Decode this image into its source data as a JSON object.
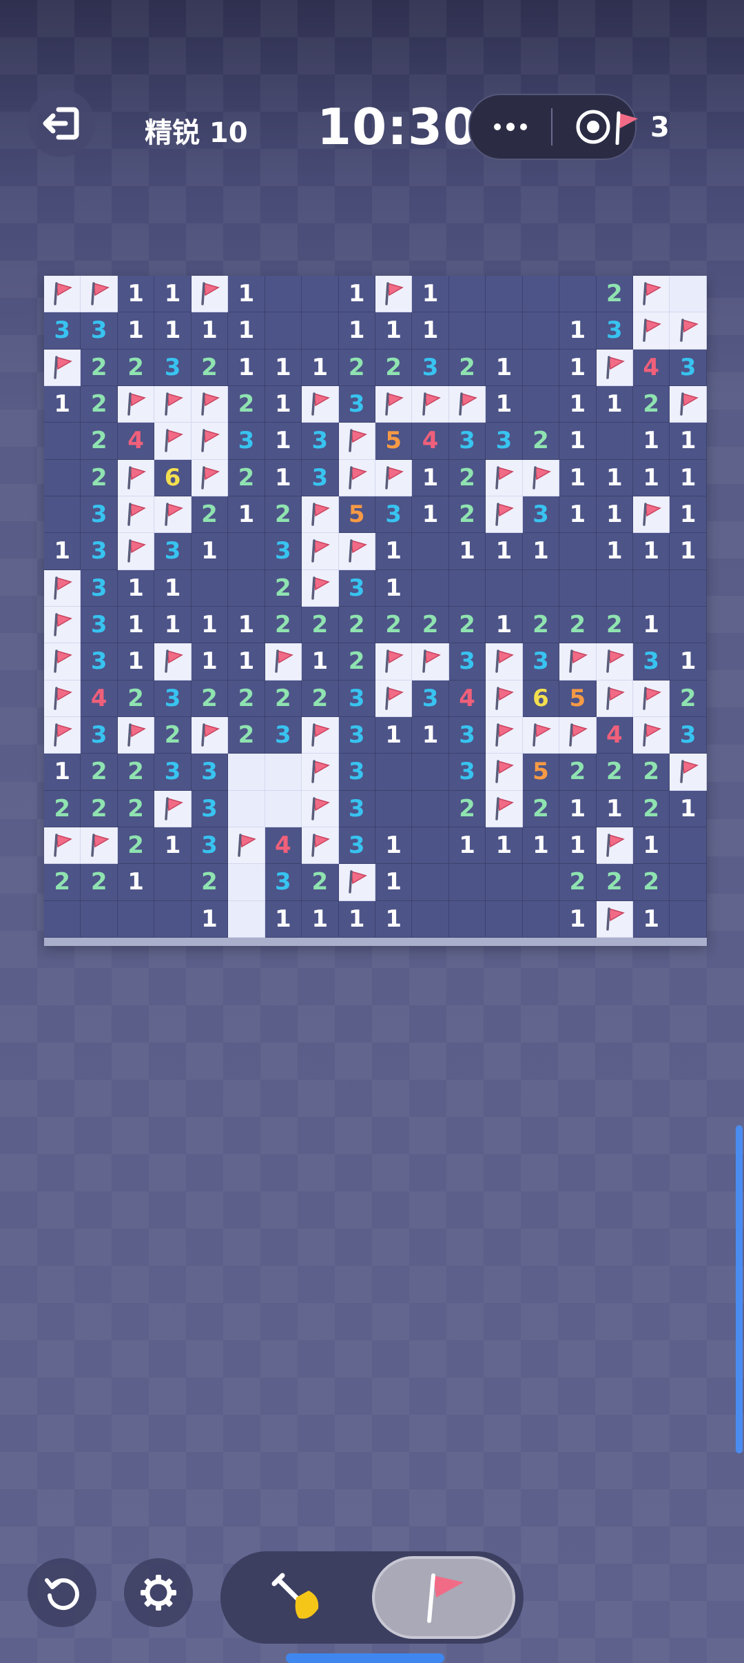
{
  "header": {
    "level_label": "精锐 10",
    "timer": "10:30",
    "flags_remaining": "3"
  },
  "board": {
    "rows": 18,
    "cols": 18,
    "legend": "F = flagged cell, H = unrevealed cell, blank = revealed empty, digit = adjacent mine count",
    "cells": [
      [
        "F",
        "F",
        "1",
        "1",
        "F",
        "1",
        "",
        "",
        "1",
        "F",
        "1",
        "",
        "",
        "",
        "",
        "2",
        "F",
        "H"
      ],
      [
        "3",
        "3",
        "1",
        "1",
        "1",
        "1",
        "",
        "",
        "1",
        "1",
        "1",
        "",
        "",
        "",
        "1",
        "3",
        "F",
        "F"
      ],
      [
        "F",
        "2",
        "2",
        "3",
        "2",
        "1",
        "1",
        "1",
        "2",
        "2",
        "3",
        "2",
        "1",
        "",
        "1",
        "F",
        "4",
        "3"
      ],
      [
        "1",
        "2",
        "F",
        "F",
        "F",
        "2",
        "1",
        "F",
        "3",
        "F",
        "F",
        "F",
        "1",
        "",
        "1",
        "1",
        "2",
        "F"
      ],
      [
        "",
        "2",
        "4",
        "F",
        "F",
        "3",
        "1",
        "3",
        "F",
        "5",
        "4",
        "3",
        "3",
        "2",
        "1",
        "",
        "1",
        "1"
      ],
      [
        "",
        "2",
        "F",
        "6",
        "F",
        "2",
        "1",
        "3",
        "F",
        "F",
        "1",
        "2",
        "F",
        "F",
        "1",
        "1",
        "1",
        "1"
      ],
      [
        "",
        "3",
        "F",
        "F",
        "2",
        "1",
        "2",
        "F",
        "5",
        "3",
        "1",
        "2",
        "F",
        "3",
        "1",
        "1",
        "F",
        "1"
      ],
      [
        "1",
        "3",
        "F",
        "3",
        "1",
        "",
        "3",
        "F",
        "F",
        "1",
        "",
        "1",
        "1",
        "1",
        "",
        "1",
        "1",
        "1"
      ],
      [
        "F",
        "3",
        "1",
        "1",
        "",
        "",
        "2",
        "F",
        "3",
        "1",
        "",
        "",
        "",
        "",
        "",
        "",
        "",
        ""
      ],
      [
        "F",
        "3",
        "1",
        "1",
        "1",
        "1",
        "2",
        "2",
        "2",
        "2",
        "2",
        "2",
        "1",
        "2",
        "2",
        "2",
        "1",
        ""
      ],
      [
        "F",
        "3",
        "1",
        "F",
        "1",
        "1",
        "F",
        "1",
        "2",
        "F",
        "F",
        "3",
        "F",
        "3",
        "F",
        "F",
        "3",
        "1"
      ],
      [
        "F",
        "4",
        "2",
        "3",
        "2",
        "2",
        "2",
        "2",
        "3",
        "F",
        "3",
        "4",
        "F",
        "6",
        "5",
        "F",
        "F",
        "2"
      ],
      [
        "F",
        "3",
        "F",
        "2",
        "F",
        "2",
        "3",
        "F",
        "3",
        "1",
        "1",
        "3",
        "F",
        "F",
        "F",
        "4",
        "F",
        "3"
      ],
      [
        "1",
        "2",
        "2",
        "3",
        "3",
        "H",
        "H",
        "F",
        "3",
        "",
        "",
        "3",
        "F",
        "5",
        "2",
        "2",
        "2",
        "F"
      ],
      [
        "2",
        "2",
        "2",
        "F",
        "3",
        "H",
        "H",
        "F",
        "3",
        "",
        "",
        "2",
        "F",
        "2",
        "1",
        "1",
        "2",
        "1"
      ],
      [
        "F",
        "F",
        "2",
        "1",
        "3",
        "F",
        "4",
        "F",
        "3",
        "1",
        "",
        "1",
        "1",
        "1",
        "1",
        "F",
        "1",
        ""
      ],
      [
        "2",
        "2",
        "1",
        "",
        "2",
        "H",
        "3",
        "2",
        "F",
        "1",
        "",
        "",
        "",
        "",
        "2",
        "2",
        "2",
        ""
      ],
      [
        "",
        "",
        "",
        "",
        "1",
        "H",
        "1",
        "1",
        "1",
        "1",
        "",
        "",
        "",
        "",
        "1",
        "F",
        "1",
        ""
      ]
    ]
  },
  "colors": {
    "board_bg": "#4d5488",
    "unrevealed": "#e9ecfb",
    "flag": "#f26b86",
    "num_1": "#ffffff",
    "num_2": "#8fe3b0",
    "num_3": "#38c3f0",
    "num_4": "#f0607a",
    "num_5": "#f79a45",
    "num_6": "#f3df4e",
    "accent": "#3f86ef"
  },
  "icons": {
    "exit": "exit-icon",
    "more": "more-dots-icon",
    "target": "target-icon",
    "flag": "flag-icon",
    "undo": "undo-icon",
    "settings": "gear-icon",
    "dig": "shovel-icon"
  },
  "mode": {
    "selected": "flag"
  }
}
